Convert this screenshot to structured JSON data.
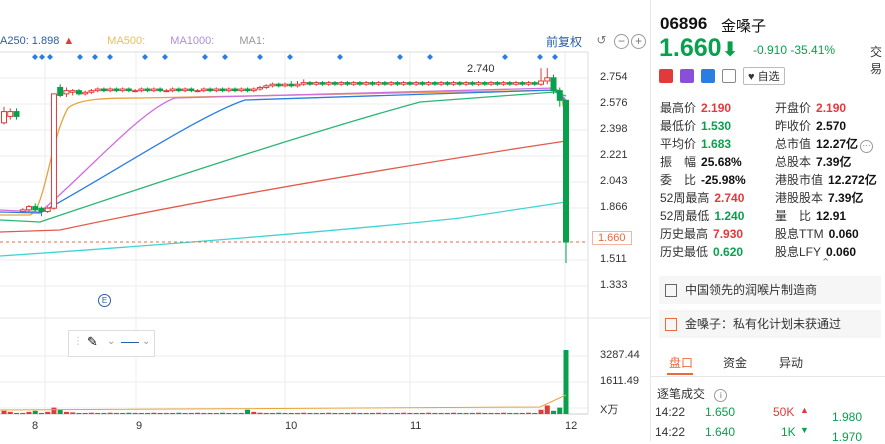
{
  "legend": {
    "ma250": "A250: 1.898",
    "ma500": "MA500:",
    "ma1000": "MA1000:",
    "ma1": "MA1:"
  },
  "controls": {
    "adjust_label": "前复权"
  },
  "chart_data": {
    "type": "candlestick",
    "x_ticks": [
      "8",
      "9",
      "10",
      "11",
      "12"
    ],
    "y_ticks": [
      "2.754",
      "2.576",
      "2.398",
      "2.221",
      "2.043",
      "1.866",
      "1.688",
      "1.511",
      "1.333"
    ],
    "current_price_tag": "1.660",
    "high_annotation": "2.740",
    "event_marker": "E",
    "volume_ticks": [
      "3287.44",
      "1611.49"
    ],
    "volume_unit": "X万",
    "price_range": [
      1.3,
      2.84
    ],
    "candles": [
      [
        2.4,
        2.47,
        2.39,
        2.5
      ],
      [
        2.44,
        2.47,
        2.42,
        2.49
      ],
      [
        2.47,
        2.44,
        2.42,
        2.49
      ],
      [
        1.85,
        1.86,
        1.84,
        1.87
      ],
      [
        1.86,
        1.88,
        1.85,
        1.89
      ],
      [
        1.88,
        1.86,
        1.85,
        1.9
      ],
      [
        1.87,
        1.85,
        1.82,
        1.88
      ],
      [
        1.85,
        1.87,
        1.84,
        1.88
      ],
      [
        1.87,
        2.58,
        1.86,
        2.3
      ],
      [
        2.62,
        2.57,
        2.56,
        2.64
      ],
      [
        2.58,
        2.6,
        2.56,
        2.62
      ],
      [
        2.59,
        2.6,
        2.57,
        2.61
      ],
      [
        2.6,
        2.58,
        2.57,
        2.61
      ],
      [
        2.58,
        2.59,
        2.57,
        2.6
      ],
      [
        2.59,
        2.6,
        2.58,
        2.61
      ],
      [
        2.6,
        2.61,
        2.59,
        2.62
      ],
      [
        2.61,
        2.6,
        2.59,
        2.62
      ],
      [
        2.6,
        2.61,
        2.59,
        2.62
      ],
      [
        2.61,
        2.6,
        2.59,
        2.62
      ],
      [
        2.6,
        2.61,
        2.59,
        2.62
      ],
      [
        2.61,
        2.6,
        2.59,
        2.62
      ],
      [
        2.6,
        2.6,
        2.59,
        2.61
      ],
      [
        2.6,
        2.61,
        2.59,
        2.62
      ],
      [
        2.61,
        2.6,
        2.59,
        2.62
      ],
      [
        2.6,
        2.61,
        2.59,
        2.62
      ],
      [
        2.61,
        2.6,
        2.59,
        2.62
      ],
      [
        2.6,
        2.6,
        2.59,
        2.61
      ],
      [
        2.6,
        2.61,
        2.59,
        2.62
      ],
      [
        2.61,
        2.6,
        2.59,
        2.62
      ],
      [
        2.6,
        2.61,
        2.59,
        2.62
      ],
      [
        2.61,
        2.6,
        2.59,
        2.62
      ],
      [
        2.6,
        2.6,
        2.59,
        2.61
      ],
      [
        2.6,
        2.61,
        2.59,
        2.62
      ],
      [
        2.61,
        2.6,
        2.59,
        2.62
      ],
      [
        2.6,
        2.61,
        2.59,
        2.62
      ],
      [
        2.61,
        2.6,
        2.59,
        2.62
      ],
      [
        2.6,
        2.61,
        2.59,
        2.62
      ],
      [
        2.61,
        2.6,
        2.59,
        2.62
      ],
      [
        2.6,
        2.61,
        2.59,
        2.62
      ],
      [
        2.61,
        2.6,
        2.59,
        2.62
      ],
      [
        2.6,
        2.61,
        2.59,
        2.62
      ],
      [
        2.61,
        2.62,
        2.6,
        2.63
      ],
      [
        2.62,
        2.63,
        2.61,
        2.64
      ],
      [
        2.63,
        2.64,
        2.62,
        2.65
      ],
      [
        2.64,
        2.63,
        2.62,
        2.65
      ],
      [
        2.63,
        2.64,
        2.62,
        2.65
      ],
      [
        2.64,
        2.63,
        2.62,
        2.66
      ],
      [
        2.63,
        2.64,
        2.62,
        2.66
      ],
      [
        2.64,
        2.65,
        2.63,
        2.67
      ],
      [
        2.65,
        2.64,
        2.63,
        2.66
      ],
      [
        2.64,
        2.65,
        2.63,
        2.66
      ],
      [
        2.65,
        2.64,
        2.63,
        2.66
      ],
      [
        2.64,
        2.65,
        2.63,
        2.66
      ],
      [
        2.65,
        2.64,
        2.63,
        2.66
      ],
      [
        2.64,
        2.65,
        2.63,
        2.66
      ],
      [
        2.65,
        2.64,
        2.63,
        2.66
      ],
      [
        2.64,
        2.65,
        2.63,
        2.66
      ],
      [
        2.65,
        2.64,
        2.63,
        2.66
      ],
      [
        2.64,
        2.65,
        2.63,
        2.66
      ],
      [
        2.65,
        2.64,
        2.63,
        2.66
      ],
      [
        2.64,
        2.65,
        2.63,
        2.66
      ],
      [
        2.65,
        2.64,
        2.63,
        2.66
      ],
      [
        2.64,
        2.65,
        2.63,
        2.66
      ],
      [
        2.65,
        2.64,
        2.63,
        2.66
      ],
      [
        2.64,
        2.65,
        2.63,
        2.66
      ],
      [
        2.65,
        2.64,
        2.63,
        2.66
      ],
      [
        2.64,
        2.65,
        2.63,
        2.66
      ],
      [
        2.65,
        2.64,
        2.63,
        2.66
      ],
      [
        2.64,
        2.65,
        2.63,
        2.66
      ],
      [
        2.65,
        2.64,
        2.63,
        2.66
      ],
      [
        2.64,
        2.65,
        2.63,
        2.66
      ],
      [
        2.65,
        2.64,
        2.63,
        2.66
      ],
      [
        2.64,
        2.65,
        2.63,
        2.66
      ],
      [
        2.65,
        2.64,
        2.63,
        2.66
      ],
      [
        2.64,
        2.65,
        2.63,
        2.66
      ],
      [
        2.65,
        2.64,
        2.63,
        2.66
      ],
      [
        2.64,
        2.65,
        2.63,
        2.66
      ],
      [
        2.65,
        2.64,
        2.63,
        2.66
      ],
      [
        2.64,
        2.65,
        2.63,
        2.66
      ],
      [
        2.65,
        2.64,
        2.63,
        2.66
      ],
      [
        2.64,
        2.65,
        2.63,
        2.66
      ],
      [
        2.65,
        2.64,
        2.63,
        2.66
      ],
      [
        2.64,
        2.65,
        2.63,
        2.66
      ],
      [
        2.65,
        2.64,
        2.63,
        2.66
      ],
      [
        2.64,
        2.65,
        2.63,
        2.66
      ],
      [
        2.65,
        2.64,
        2.63,
        2.66
      ],
      [
        2.64,
        2.66,
        2.63,
        2.74
      ],
      [
        2.66,
        2.68,
        2.64,
        2.74
      ],
      [
        2.68,
        2.6,
        2.58,
        2.7
      ],
      [
        2.6,
        2.54,
        2.5,
        2.62
      ],
      [
        2.54,
        1.66,
        1.53,
        2.19
      ]
    ],
    "volumes": [
      30,
      20,
      10,
      10,
      20,
      30,
      10,
      20,
      60,
      40,
      20,
      15,
      10,
      10,
      12,
      10,
      10,
      12,
      10,
      10,
      12,
      10,
      10,
      10,
      12,
      10,
      10,
      10,
      12,
      10,
      10,
      12,
      10,
      10,
      10,
      12,
      10,
      10,
      10,
      40,
      20,
      12,
      10,
      10,
      12,
      10,
      10,
      10,
      12,
      10,
      10,
      10,
      12,
      10,
      10,
      10,
      12,
      10,
      10,
      10,
      12,
      10,
      10,
      10,
      12,
      10,
      10,
      10,
      12,
      10,
      10,
      10,
      12,
      10,
      10,
      10,
      12,
      10,
      10,
      10,
      12,
      10,
      10,
      10,
      12,
      10,
      40,
      80,
      30,
      60,
      600
    ]
  },
  "stock": {
    "code": "06896",
    "name": "金嗓子",
    "price": "1.660",
    "change": "-0.910",
    "change_pct": "-35.41%",
    "trade_label": "交易"
  },
  "buttons": {
    "favorite": "自选"
  },
  "stats": {
    "high_label": "最高价",
    "high": "2.190",
    "open_label": "开盘价",
    "open": "2.190",
    "low_label": "最低价",
    "low": "1.530",
    "prev_label": "昨收价",
    "prev": "2.570",
    "avg_label": "平均价",
    "avg": "1.683",
    "mktcap_label": "总市值",
    "mktcap": "12.27亿",
    "amp_label": "振　幅",
    "amp": "25.68%",
    "shares_label": "总股本",
    "shares": "7.39亿",
    "wb_label": "委　比",
    "wb": "-25.98%",
    "hkcap_label": "港股市值",
    "hkcap": "12.272亿",
    "w52h_label": "52周最高",
    "w52h": "2.740",
    "hkshares_label": "港股股本",
    "hkshares": "7.39亿",
    "w52l_label": "52周最低",
    "w52l": "1.240",
    "vr_label": "量　比",
    "vr": "12.91",
    "hh_label": "历史最高",
    "hh": "7.930",
    "ttm_label": "股息TTM",
    "ttm": "0.060",
    "hl_label": "历史最低",
    "hl": "0.620",
    "lfy_label": "股息LFY",
    "lfy": "0.060"
  },
  "news": [
    "中国领先的润喉片制造商",
    "金嗓子：私有化计划未获通过"
  ],
  "tabs": [
    "盘口",
    "资金",
    "异动"
  ],
  "ticks": {
    "title": "逐笔成交",
    "rows": [
      {
        "time": "14:22",
        "price": "1.650",
        "vol": "50K",
        "side": "up",
        "right": "1.980"
      },
      {
        "time": "14:22",
        "price": "1.640",
        "vol": "1K",
        "side": "down",
        "right": "1.970"
      }
    ]
  },
  "colors": {
    "up": "#e23a3a",
    "down": "#08a04d",
    "accent": "#e66c3c",
    "link": "#2a5caa"
  }
}
